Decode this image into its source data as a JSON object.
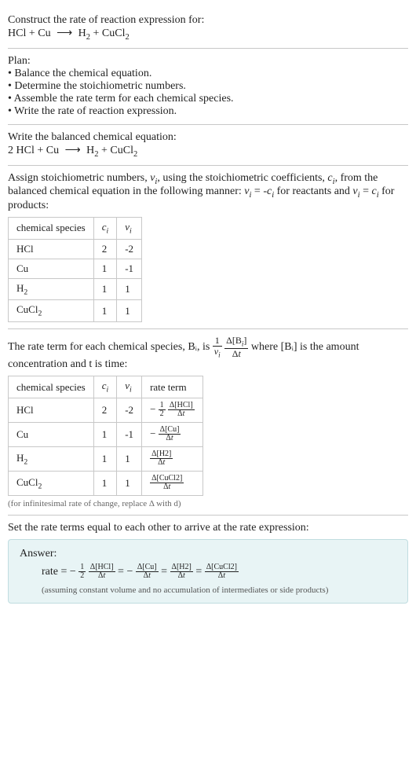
{
  "prompt": {
    "title": "Construct the rate of reaction expression for:",
    "equation_raw": "HCl + Cu ⟶ H₂ + CuCl₂"
  },
  "plan": {
    "heading": "Plan:",
    "bullets": [
      "Balance the chemical equation.",
      "Determine the stoichiometric numbers.",
      "Assemble the rate term for each chemical species.",
      "Write the rate of reaction expression."
    ]
  },
  "balanced": {
    "heading": "Write the balanced chemical equation:",
    "equation": "2 HCl + Cu ⟶ H₂ + CuCl₂"
  },
  "stoich": {
    "intro1": "Assign stoichiometric numbers, νᵢ, using the stoichiometric coefficients, cᵢ, from the balanced chemical equation in the following manner: νᵢ = -cᵢ for reactants and νᵢ = cᵢ for products:",
    "headers": [
      "chemical species",
      "cᵢ",
      "νᵢ"
    ],
    "rows": [
      {
        "species": "HCl",
        "c": "2",
        "v": "-2"
      },
      {
        "species": "Cu",
        "c": "1",
        "v": "-1"
      },
      {
        "species": "H₂",
        "c": "1",
        "v": "1"
      },
      {
        "species": "CuCl₂",
        "c": "1",
        "v": "1"
      }
    ]
  },
  "rate_term": {
    "intro_a": "The rate term for each chemical species, Bᵢ, is ",
    "intro_b": " where [Bᵢ] is the amount concentration and t is time:",
    "headers": [
      "chemical species",
      "cᵢ",
      "νᵢ",
      "rate term"
    ],
    "rows": [
      {
        "species": "HCl",
        "c": "2",
        "v": "-2",
        "coef_neg": "−",
        "coef_frac_num": "1",
        "coef_frac_den": "2",
        "num": "Δ[HCl]",
        "den": "Δt"
      },
      {
        "species": "Cu",
        "c": "1",
        "v": "-1",
        "coef_neg": "−",
        "coef_frac_num": "",
        "coef_frac_den": "",
        "num": "Δ[Cu]",
        "den": "Δt"
      },
      {
        "species": "H₂",
        "c": "1",
        "v": "1",
        "coef_neg": "",
        "coef_frac_num": "",
        "coef_frac_den": "",
        "num": "Δ[H2]",
        "den": "Δt"
      },
      {
        "species": "CuCl₂",
        "c": "1",
        "v": "1",
        "coef_neg": "",
        "coef_frac_num": "",
        "coef_frac_den": "",
        "num": "Δ[CuCl2]",
        "den": "Δt"
      }
    ],
    "note": "(for infinitesimal rate of change, replace Δ with d)"
  },
  "final": {
    "heading": "Set the rate terms equal to each other to arrive at the rate expression:",
    "answer_label": "Answer:",
    "rate_label": "rate = ",
    "eq1_neg": "−",
    "eq1_frac_num": "1",
    "eq1_frac_den": "2",
    "eq1_num": "Δ[HCl]",
    "eq1_den": "Δt",
    "eq2_neg": "−",
    "eq2_num": "Δ[Cu]",
    "eq2_den": "Δt",
    "eq3_num": "Δ[H2]",
    "eq3_den": "Δt",
    "eq4_num": "Δ[CuCl2]",
    "eq4_den": "Δt",
    "note": "(assuming constant volume and no accumulation of intermediates or side products)"
  }
}
